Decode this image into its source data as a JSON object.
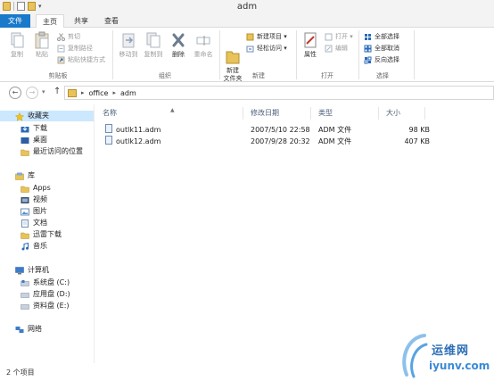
{
  "window": {
    "title": "adm"
  },
  "ribbon_tabs": {
    "file": "文件",
    "home": "主页",
    "share": "共享",
    "view": "查看"
  },
  "clipboard": {
    "copy": "复制",
    "paste": "粘贴",
    "cut": "剪切",
    "copy_path": "复制路径",
    "paste_shortcut": "粘贴快捷方式",
    "group": "剪贴板"
  },
  "organize": {
    "move_to": "移动到",
    "copy_to": "复制到",
    "delete": "删除",
    "rename": "重命名",
    "group": "组织"
  },
  "new_group": {
    "new_folder": "新建\n文件夹",
    "new_item": "新建项目 ▾",
    "easy_access": "轻松访问 ▾",
    "group": "新建"
  },
  "open_group": {
    "properties": "属性",
    "open": "打开 ▾",
    "edit": "编辑",
    "group": "打开"
  },
  "select_group": {
    "select_all": "全部选择",
    "select_none": "全部取消",
    "invert": "反向选择",
    "group": "选择"
  },
  "address": {
    "crumbs": [
      "office",
      "adm"
    ]
  },
  "nav": {
    "favorites": "收藏夹",
    "downloads": "下载",
    "desktop": "桌面",
    "recent": "最近访问的位置",
    "libraries": "库",
    "apps": "Apps",
    "videos": "视频",
    "pictures": "图片",
    "documents": "文档",
    "thunder": "迅雷下载",
    "music": "音乐",
    "computer": "计算机",
    "drive_c": "系统盘 (C:)",
    "drive_d": "应用盘 (D:)",
    "drive_e": "资料盘 (E:)",
    "network": "网络"
  },
  "columns": {
    "name": "名称",
    "date": "修改日期",
    "type": "类型",
    "size": "大小"
  },
  "files": [
    {
      "name": "outlk11.adm",
      "date": "2007/5/10 22:58",
      "type": "ADM 文件",
      "size": "98 KB"
    },
    {
      "name": "outlk12.adm",
      "date": "2007/9/28 20:32",
      "type": "ADM 文件",
      "size": "407 KB"
    }
  ],
  "status": {
    "count": "2 个项目"
  },
  "watermark": {
    "brand": "运维网",
    "url": "iyunv.com"
  },
  "colors": {
    "accent": "#1979ca",
    "folder": "#e8c35a",
    "selection": "#cce8ff"
  }
}
